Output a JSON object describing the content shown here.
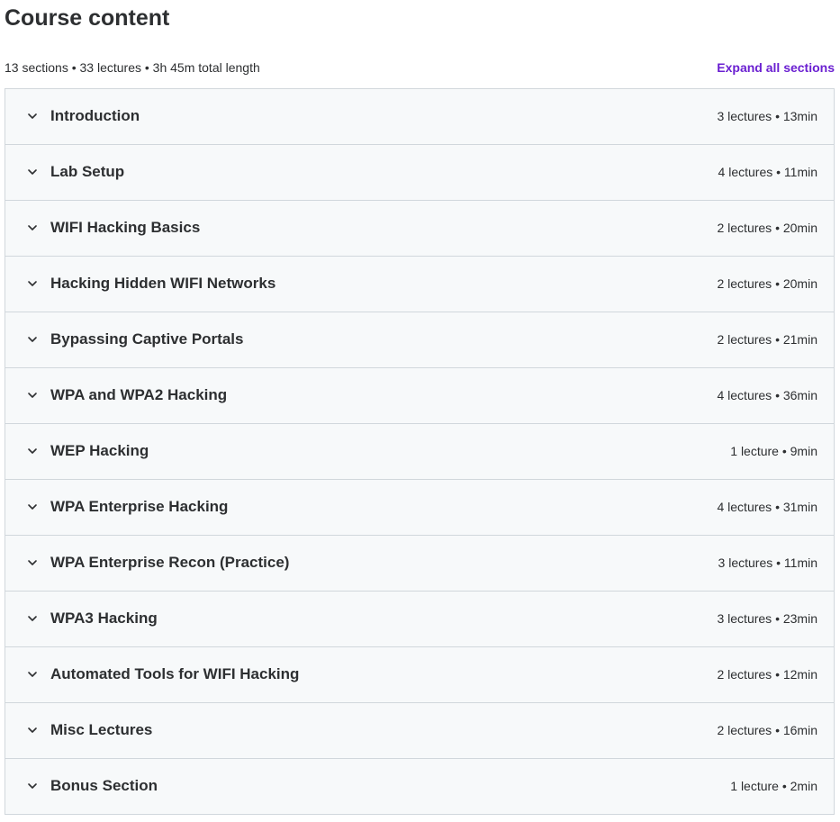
{
  "header": {
    "title": "Course content",
    "summary": "13 sections • 33 lectures • 3h 45m total length",
    "expand_all_label": "Expand all sections"
  },
  "icons": {
    "section_toggle": "chevron-down-icon"
  },
  "colors": {
    "accent": "#6a1fd1",
    "section_background": "#f7f9fa",
    "border": "#d1d7dc",
    "text": "#2d2f31"
  },
  "sections": [
    {
      "title": "Introduction",
      "meta": "3 lectures • 13min"
    },
    {
      "title": "Lab Setup",
      "meta": "4 lectures • 11min"
    },
    {
      "title": "WIFI Hacking Basics",
      "meta": "2 lectures • 20min"
    },
    {
      "title": "Hacking Hidden WIFI Networks",
      "meta": "2 lectures • 20min"
    },
    {
      "title": "Bypassing Captive Portals",
      "meta": "2 lectures • 21min"
    },
    {
      "title": "WPA and WPA2 Hacking",
      "meta": "4 lectures • 36min"
    },
    {
      "title": "WEP Hacking",
      "meta": "1 lecture • 9min"
    },
    {
      "title": "WPA Enterprise Hacking",
      "meta": "4 lectures • 31min"
    },
    {
      "title": "WPA Enterprise Recon (Practice)",
      "meta": "3 lectures • 11min"
    },
    {
      "title": "WPA3 Hacking",
      "meta": "3 lectures • 23min"
    },
    {
      "title": "Automated Tools for WIFI Hacking",
      "meta": "2 lectures • 12min"
    },
    {
      "title": "Misc Lectures",
      "meta": "2 lectures • 16min"
    },
    {
      "title": "Bonus Section",
      "meta": "1 lecture • 2min"
    }
  ]
}
